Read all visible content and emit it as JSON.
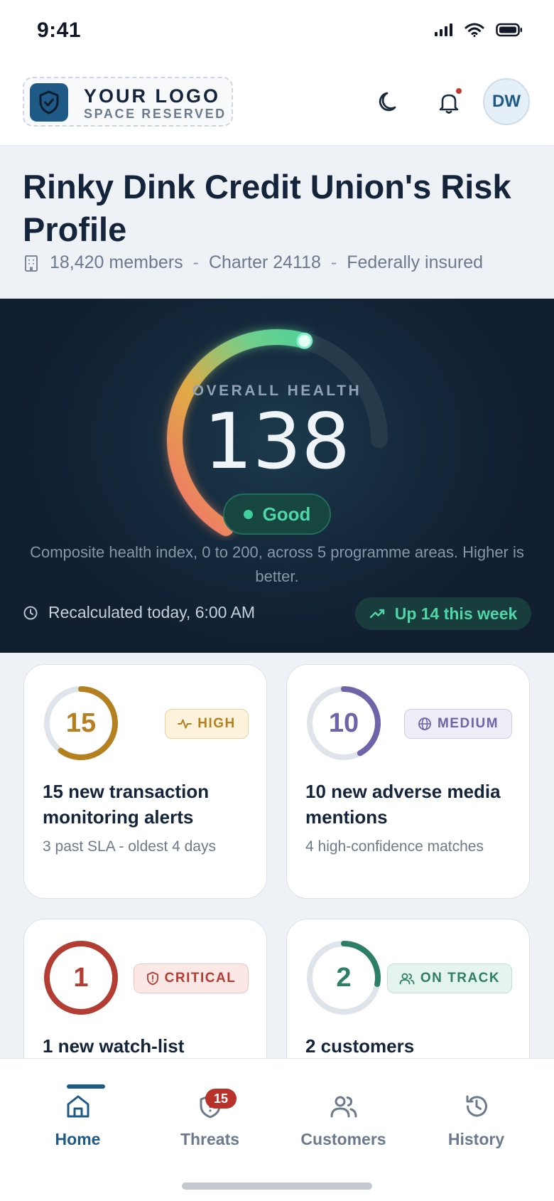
{
  "status_bar": {
    "time": "9:41"
  },
  "header": {
    "logo_title": "YOUR LOGO",
    "logo_subtitle": "SPACE RESERVED",
    "avatar_initials": "DW"
  },
  "profile": {
    "title": "Rinky Dink Credit Union's Risk Profile",
    "members": "18,420 members",
    "charter": "Charter 24118",
    "insurance": "Federally insured"
  },
  "health": {
    "label": "OVERALL HEALTH",
    "value": "138",
    "max_value": 200,
    "status": "Good",
    "description": "Composite health index, 0 to 200, across 5 programme areas. Higher is better.",
    "recalculated": "Recalculated today, 6:00 AM",
    "trend": "Up 14 this week"
  },
  "cards": [
    {
      "count": "15",
      "badge": "HIGH",
      "badge_icon": "activity-icon",
      "title": "15 new transaction monitoring alerts",
      "subtitle": "3 past SLA - oldest 4 days",
      "color": "#b5801f",
      "ring_fraction": 0.6
    },
    {
      "count": "10",
      "badge": "MEDIUM",
      "badge_icon": "globe-icon",
      "title": "10 new adverse media mentions",
      "subtitle": "4 high-confidence matches",
      "color": "#6f64a8",
      "ring_fraction": 0.42
    },
    {
      "count": "1",
      "badge": "CRITICAL",
      "badge_icon": "shield-alert-icon",
      "title": "1 new watch-list",
      "subtitle": "",
      "color": "#b33d33",
      "ring_fraction": 1.0
    },
    {
      "count": "2",
      "badge": "ON TRACK",
      "badge_icon": "users-icon",
      "title": "2 customers",
      "subtitle": "",
      "color": "#2c7f66",
      "ring_fraction": 0.28
    }
  ],
  "nav": {
    "home": "Home",
    "threats": "Threats",
    "threats_badge": "15",
    "customers": "Customers",
    "history": "History"
  },
  "colors": {
    "brand": "#1f5a86",
    "good": "#4fd6a6",
    "panel_bg": "#13263a",
    "page_bg": "#eef2f6"
  }
}
